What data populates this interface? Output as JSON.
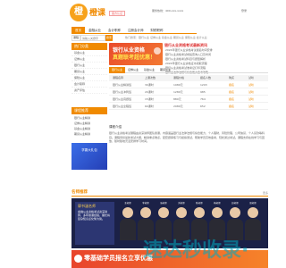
{
  "header": {
    "brand": "橙课",
    "brand_tag": "",
    "cert_badge": "官方认证",
    "hotline": "服务热线：400-xxx-xxxx",
    "login": "登录"
  },
  "nav": {
    "items": [
      "首页",
      "金融从业",
      "会计职称",
      "注册会计师",
      "财税职称"
    ]
  },
  "search": {
    "select": "课程",
    "placeholder": "请输入关键字",
    "button": "搜索",
    "hot": "热门搜索：银行从业 证券从业 基金从业 期货从业 保险从业 会计从业"
  },
  "sidebar": {
    "title": "热门分类",
    "items": [
      "基金从业",
      "证券从业",
      "银行从业",
      "期货从业",
      "保险从业",
      "会计职称",
      "资产评估"
    ],
    "promo": "金融从业"
  },
  "banner": {
    "line1": "银行从业资格",
    "line2": "真题联考超优惠！"
  },
  "news": {
    "title": "银行从业资格考试最新资讯",
    "lines": [
      "·2024年银行从业资格考试报名时间安排",
      "·银行从业资格考试成绩查询入口及时间",
      "·银行从业资格考试科目与题型解析",
      "·2024年银行从业资格证书领取流程",
      "·银行从业资格考试准考证打印流程",
      "·银行业法律法规与综合能力备考攻略"
    ]
  },
  "tabs": [
    "银行从业",
    "证券从业",
    "基金从业",
    "期货从业"
  ],
  "table": {
    "headers": [
      "课程名称",
      "上课次数",
      "课程价格",
      "报名人数",
      "购买",
      "试听"
    ],
    "rows": [
      [
        "银行从业精讲班",
        "30课时",
        "1980元",
        "1203",
        "报名",
        "试听"
      ],
      [
        "银行从业冲刺班",
        "20课时",
        "1280元",
        "985",
        "报名",
        "试听"
      ],
      [
        "银行从业真题班",
        "15课时",
        "880元",
        "764",
        "报名",
        "试听"
      ],
      [
        "银行从业全程班",
        "60课时",
        "2980元",
        "652",
        "报名",
        "试听"
      ]
    ]
  },
  "intro": {
    "label": "课程介绍",
    "text": "银行从业资格考试课程由资深讲师团队授课，内容涵盖银行业法律法规与综合能力、个人理财、风险管理、公司信贷、个人贷款等科目。课程紧扣最新考试大纲，精讲重点难点，配套题库练习与模拟测试，帮助学员高效备考，轻松通过考试。课程支持在线学习与回放，随时随地灵活安排学习时间。"
  },
  "courses": {
    "title": "课程推荐",
    "items": [
      "银行从业精讲",
      "证券从业精讲",
      "基金从业精讲",
      "期货从业精讲"
    ],
    "promo": "学霸大礼包"
  },
  "teachers": {
    "title": "名师推荐",
    "more": "更多",
    "featured_name": "郭书涵名师",
    "featured_text": "金融从业资格考试资深讲师，多年授课经验，擅长将复杂知识点化繁为简。",
    "names": [
      "王老师",
      "李老师",
      "张老师",
      "刘老师",
      "陈老师",
      "杨老师",
      "赵老师",
      "周老师"
    ]
  },
  "bottom_promo": "零基础学员报名立享优惠",
  "watermark": "速达秒收录·"
}
